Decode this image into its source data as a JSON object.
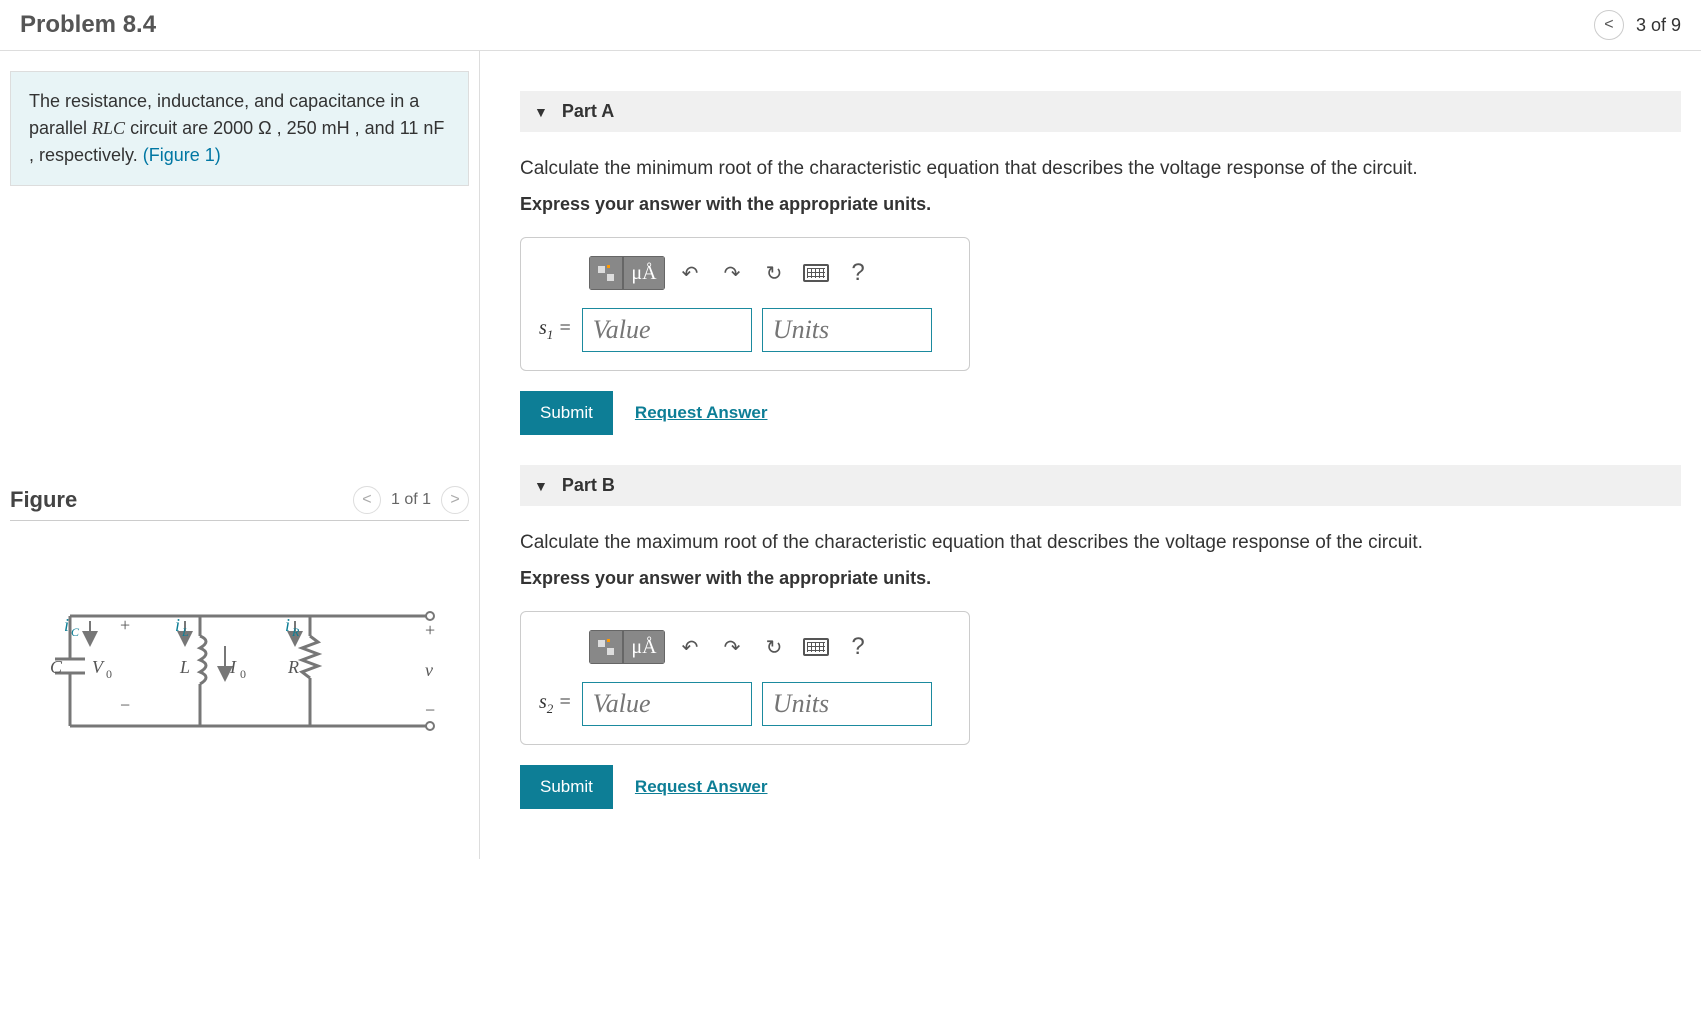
{
  "header": {
    "title": "Problem 8.4",
    "page_indicator": "3 of 9"
  },
  "problem": {
    "intro_a": "The resistance, inductance, and capacitance in a parallel ",
    "rlc": "RLC",
    "intro_b": " circuit are 2000 ",
    "ohm": "Ω",
    "intro_c": " , 250 ",
    "mh": "mH",
    "intro_d": " , and 11 ",
    "nf": "nF",
    "intro_e": " , respectively. ",
    "figure_ref": "(Figure 1)"
  },
  "figure": {
    "title": "Figure",
    "counter": "1 of 1",
    "labels": {
      "ic": "iC",
      "il": "iL",
      "ir": "iR",
      "c": "C",
      "v0": "V0",
      "l": "L",
      "i0": "I0",
      "r": "R",
      "v": "v",
      "plus": "+",
      "minus": "−"
    }
  },
  "parts": [
    {
      "label": "Part A",
      "prompt": "Calculate the minimum root of the characteristic equation that describes the voltage response of the circuit.",
      "instruction": "Express your answer with the appropriate units.",
      "variable": "s",
      "subscript": "1",
      "equals": " =",
      "value_placeholder": "Value",
      "units_placeholder": "Units",
      "units_symbol": "μÅ",
      "submit": "Submit",
      "request": "Request Answer",
      "help": "?"
    },
    {
      "label": "Part B",
      "prompt": "Calculate the maximum root of the characteristic equation that describes the voltage response of the circuit.",
      "instruction": "Express your answer with the appropriate units.",
      "variable": "s",
      "subscript": "2",
      "equals": " =",
      "value_placeholder": "Value",
      "units_placeholder": "Units",
      "units_symbol": "μÅ",
      "submit": "Submit",
      "request": "Request Answer",
      "help": "?"
    }
  ]
}
